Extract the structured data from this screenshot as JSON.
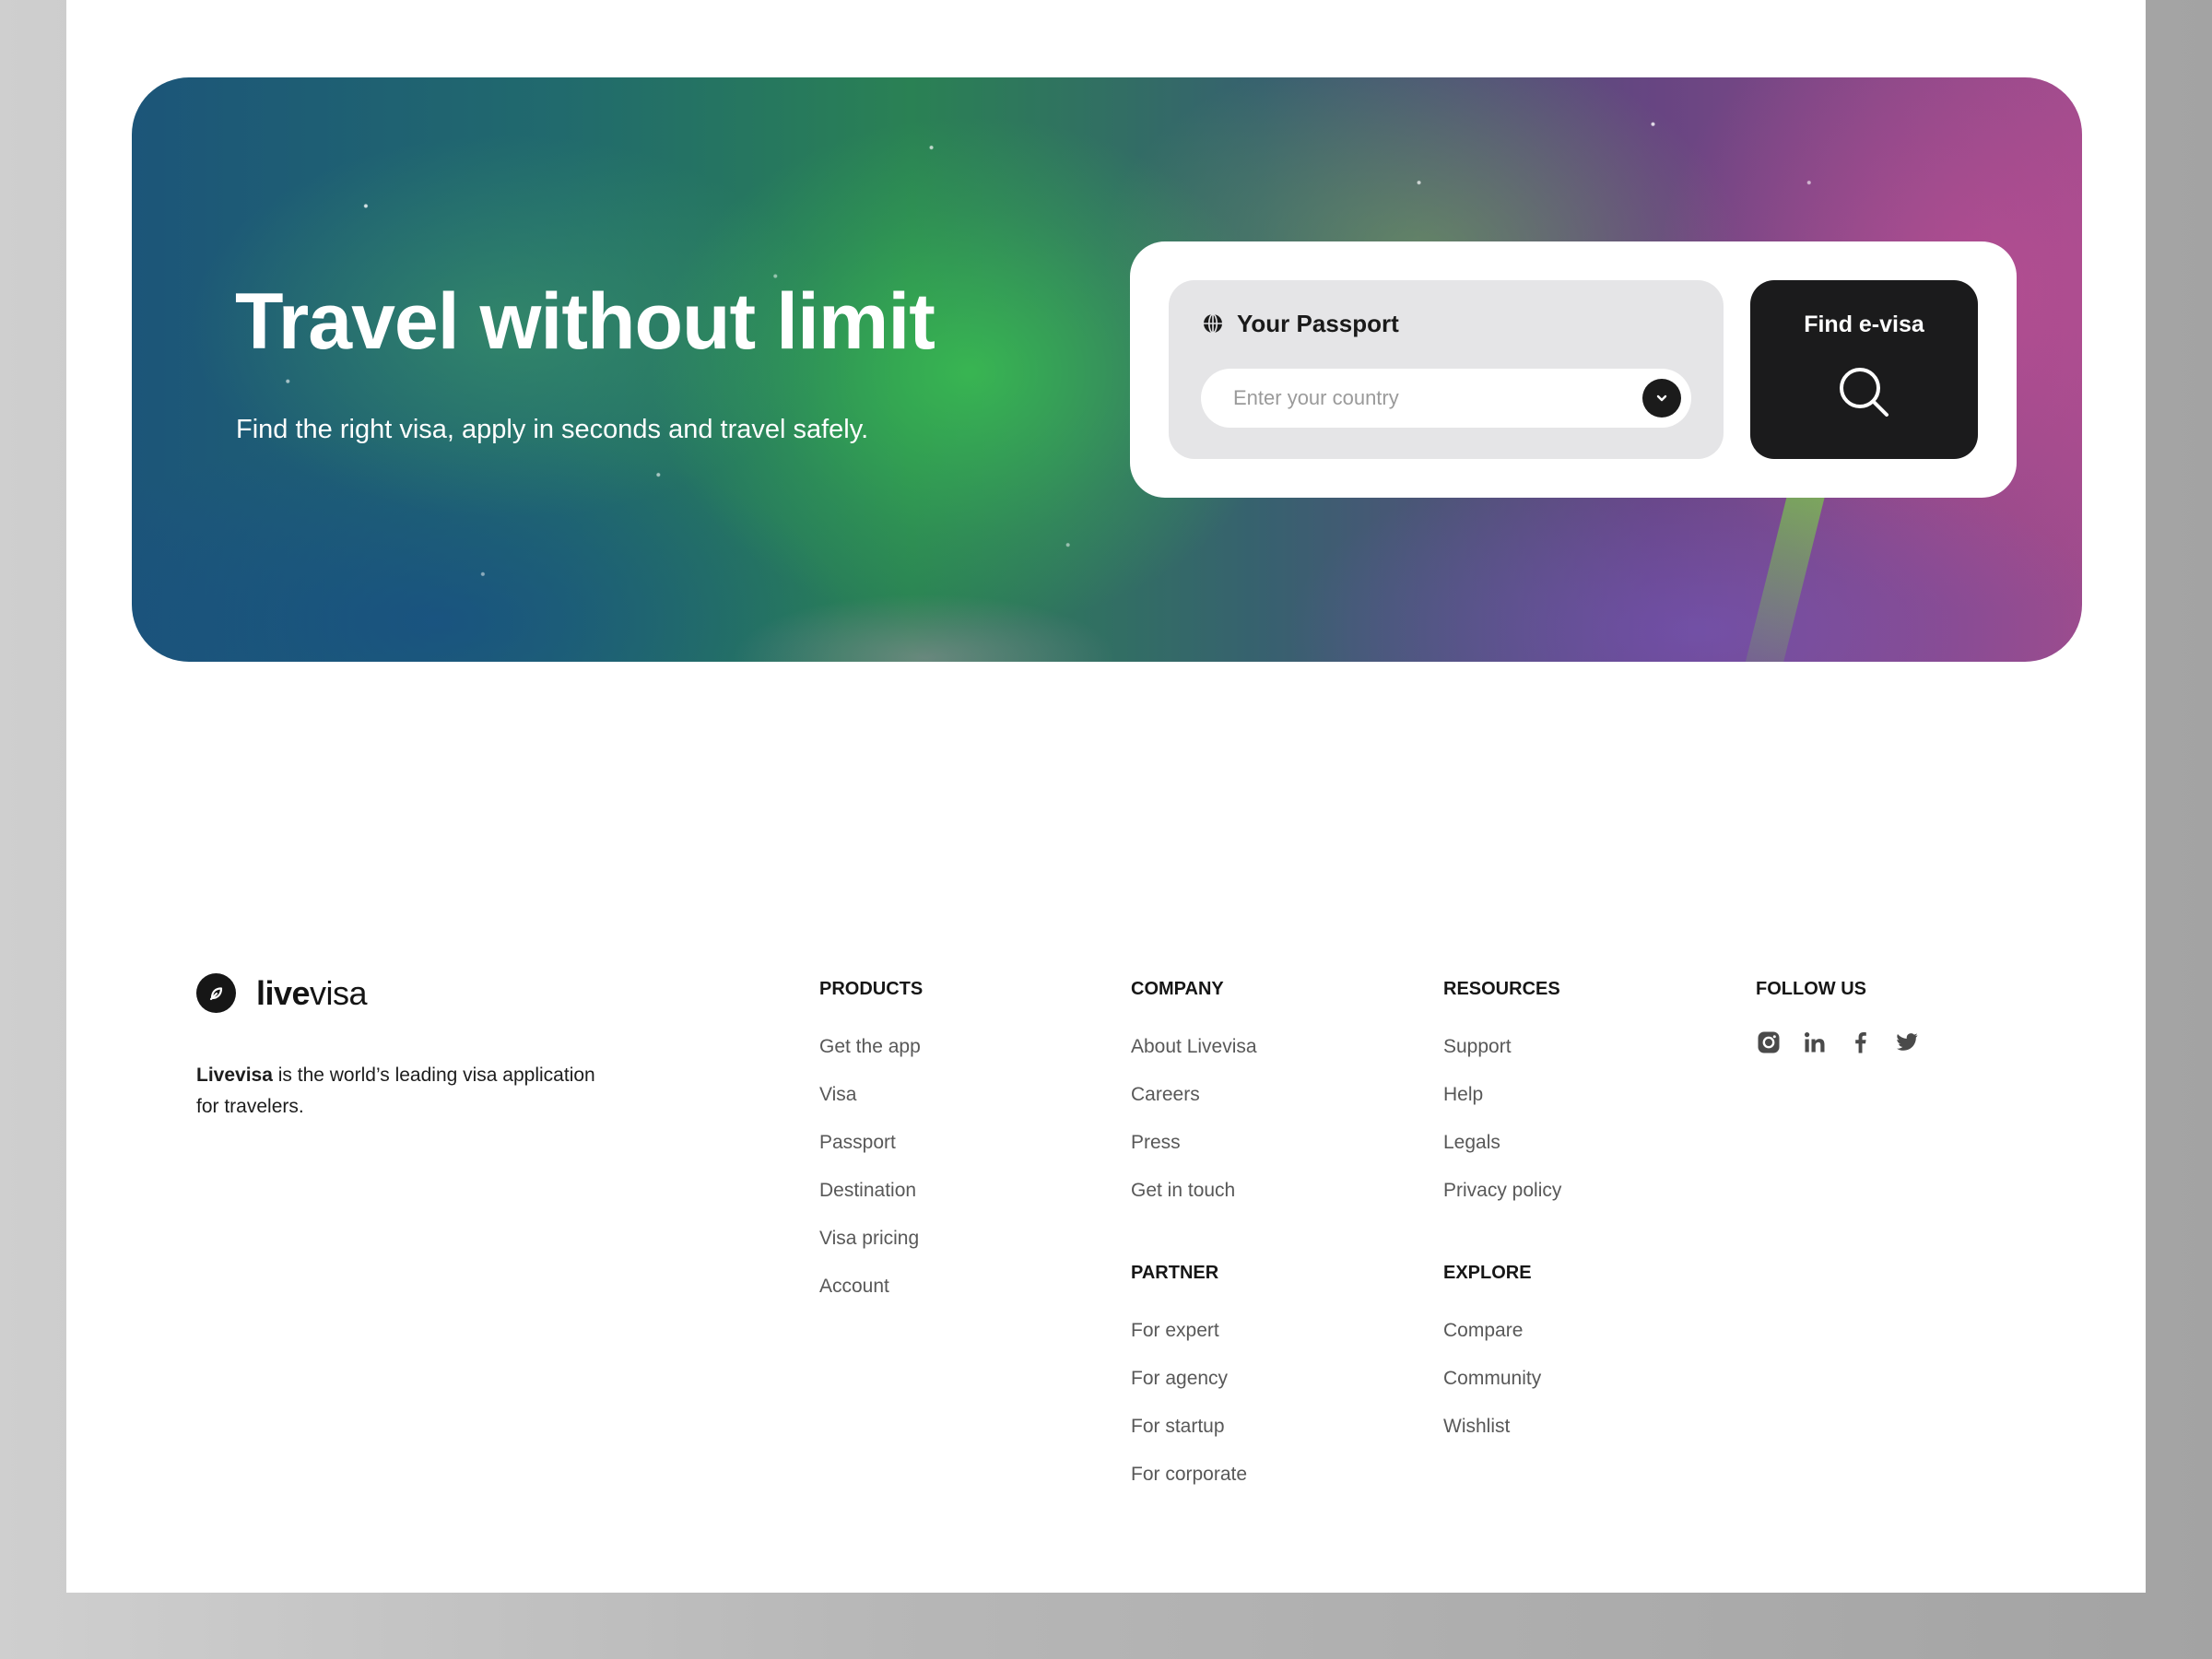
{
  "hero": {
    "title": "Travel without limit",
    "subtitle": "Find the right visa, apply in seconds and travel safely."
  },
  "search": {
    "passport_label": "Your Passport",
    "country_placeholder": "Enter your country",
    "country_value": "",
    "find_label": "Find e-visa",
    "icons": [
      "globe-icon",
      "chevron-down-icon",
      "search-icon"
    ]
  },
  "brand": {
    "name_bold": "live",
    "name_regular": "visa",
    "about_bold": "Livevisa",
    "about_rest": " is the world’s leading visa application for travelers."
  },
  "footer": {
    "products": {
      "heading": "PRODUCTS",
      "links": [
        "Get the app",
        "Visa",
        "Passport",
        "Destination",
        "Visa pricing",
        "Account"
      ]
    },
    "company": {
      "heading": "COMPANY",
      "links": [
        "About Livevisa",
        "Careers",
        "Press",
        "Get in touch"
      ]
    },
    "partner": {
      "heading": "PARTNER",
      "links": [
        "For expert",
        "For agency",
        "For startup",
        "For corporate"
      ]
    },
    "resources": {
      "heading": "RESOURCES",
      "links": [
        "Support",
        "Help",
        "Legals",
        "Privacy policy"
      ]
    },
    "explore": {
      "heading": "EXPLORE",
      "links": [
        "Compare",
        "Community",
        "Wishlist"
      ]
    },
    "follow": {
      "heading": "FOLLOW US",
      "icons": [
        "instagram-icon",
        "linkedin-icon",
        "facebook-icon",
        "twitter-icon"
      ]
    }
  },
  "colors": {
    "dark": "#1b1b1c",
    "passport_box": "#e5e5e7",
    "link_text": "#585858",
    "backdrop": "#b7b7b7"
  }
}
